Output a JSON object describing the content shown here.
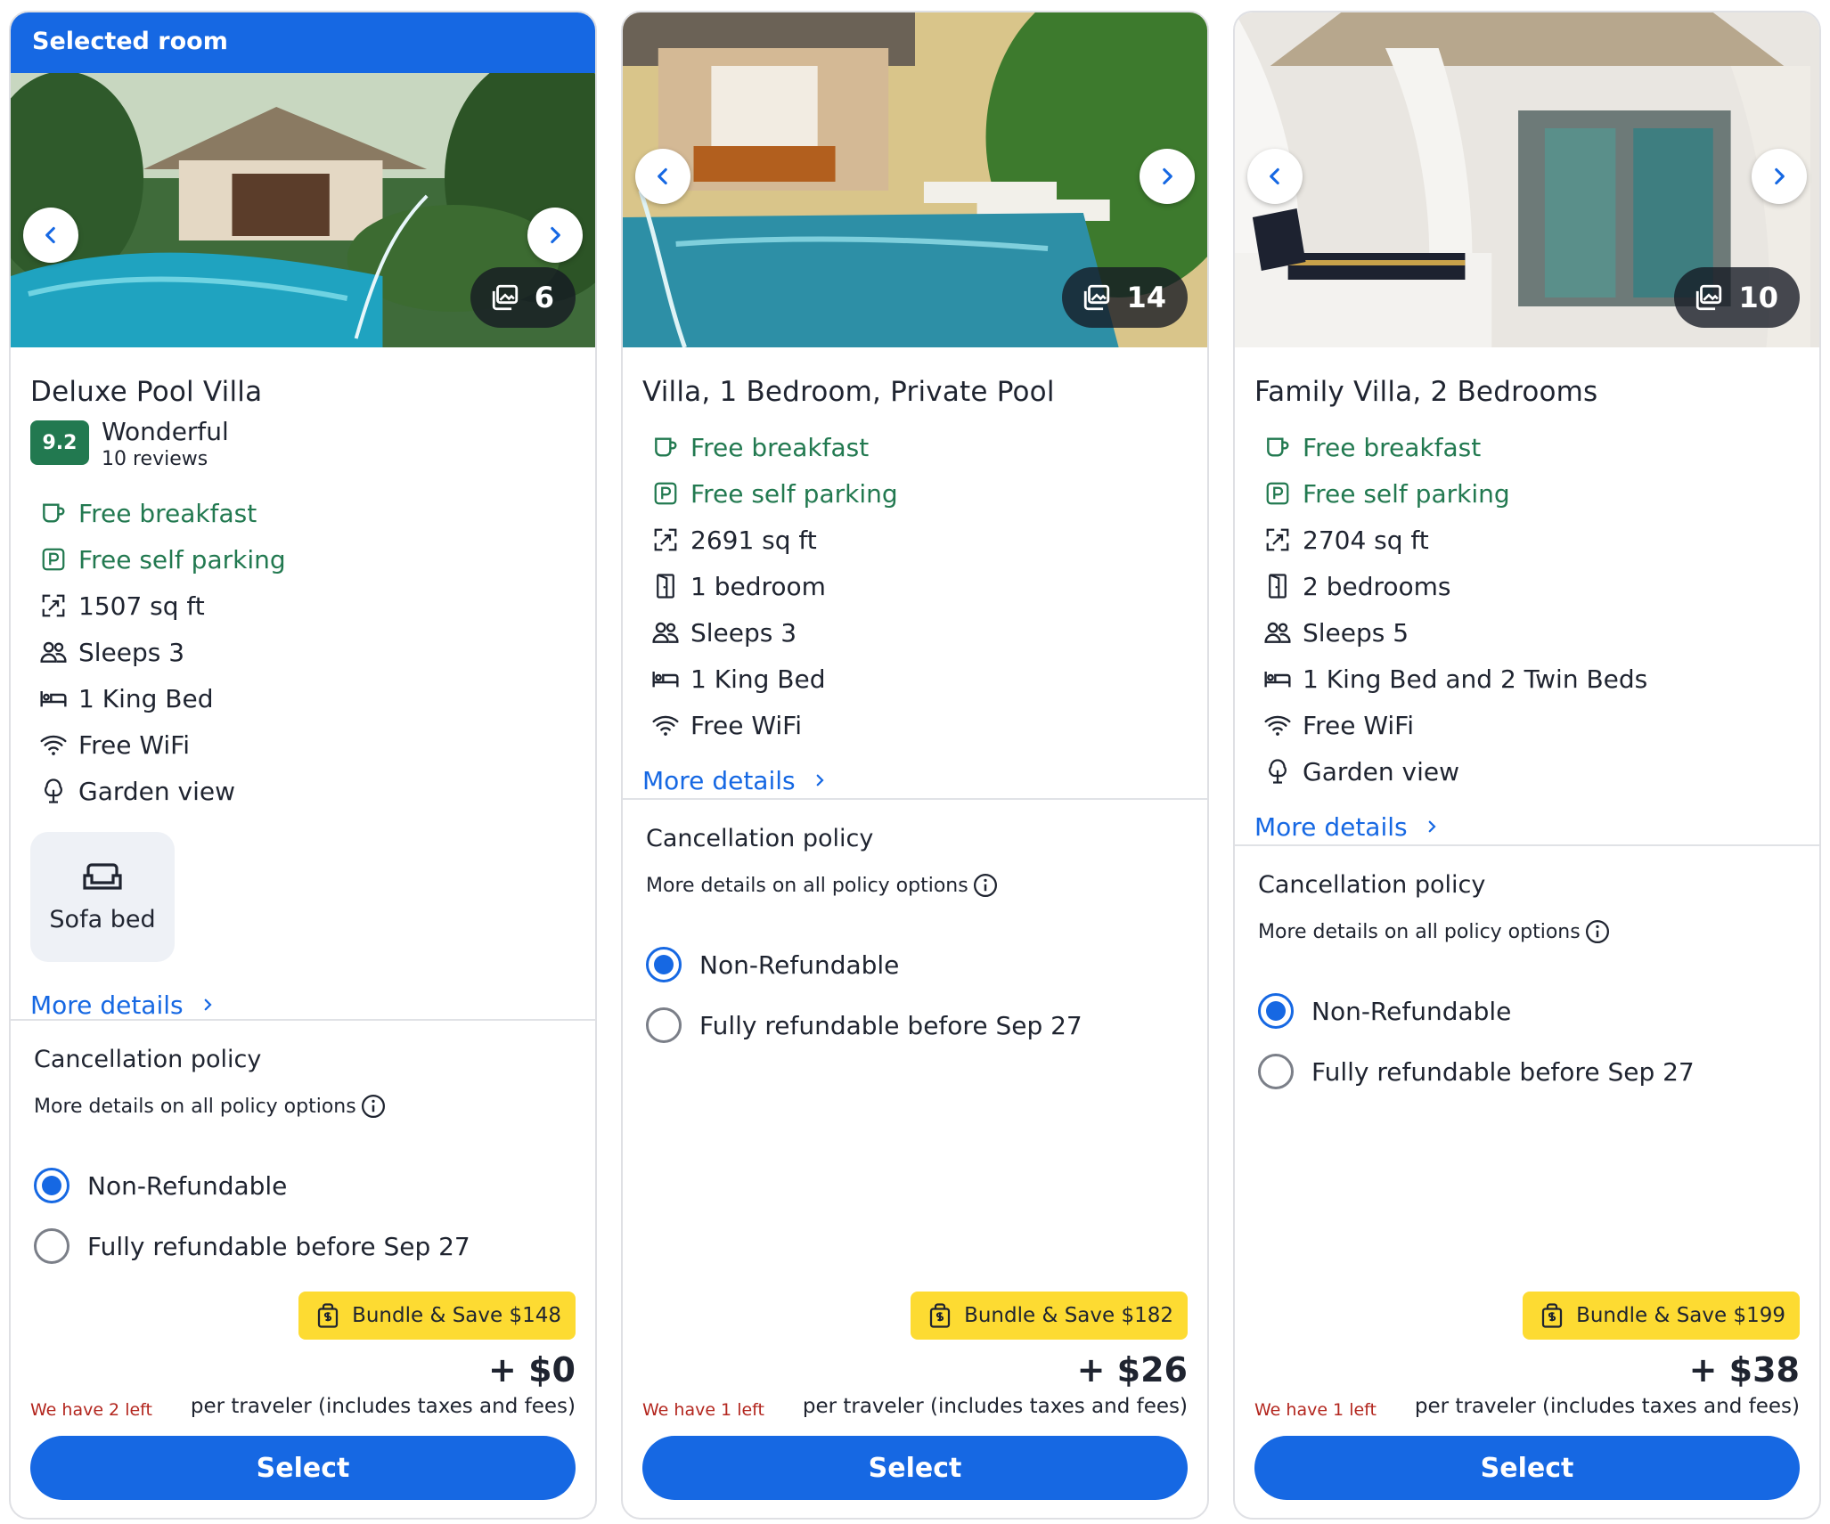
{
  "colors": {
    "accent_blue": "#1668e3",
    "amenity_green": "#227950",
    "bundle_yellow": "#fddb32",
    "scarcity_red": "#b3261e"
  },
  "cards": [
    {
      "banner": "Selected room",
      "photo_count": "6",
      "name": "Deluxe Pool Villa",
      "rating": {
        "score": "9.2",
        "label": "Wonderful",
        "reviews": "10 reviews"
      },
      "amenities": [
        {
          "icon": "coffee-cup-icon",
          "text": "Free breakfast",
          "green": true
        },
        {
          "icon": "parking-icon",
          "text": "Free self parking",
          "green": true
        },
        {
          "icon": "expand-icon",
          "text": "1507 sq ft",
          "green": false
        },
        {
          "icon": "people-icon",
          "text": "Sleeps 3",
          "green": false
        },
        {
          "icon": "bed-icon",
          "text": "1 King Bed",
          "green": false
        },
        {
          "icon": "wifi-icon",
          "text": "Free WiFi",
          "green": false
        },
        {
          "icon": "tree-icon",
          "text": "Garden view",
          "green": false
        }
      ],
      "extra_tile": {
        "icon": "sofa-icon",
        "label": "Sofa bed"
      },
      "more_details": "More details",
      "policy_title": "Cancellation policy",
      "policy_sub": "More details on all policy options",
      "options": [
        {
          "label": "Non-Refundable",
          "checked": true
        },
        {
          "label": "Fully refundable before Sep 27",
          "checked": false
        }
      ],
      "bundle": "Bundle & Save $148",
      "price": "+ $0",
      "per_traveler": "per traveler (includes taxes and fees)",
      "left": "We have 2 left",
      "select": "Select"
    },
    {
      "photo_count": "14",
      "name": "Villa, 1 Bedroom, Private Pool",
      "amenities": [
        {
          "icon": "coffee-cup-icon",
          "text": "Free breakfast",
          "green": true
        },
        {
          "icon": "parking-icon",
          "text": "Free self parking",
          "green": true
        },
        {
          "icon": "expand-icon",
          "text": "2691 sq ft",
          "green": false
        },
        {
          "icon": "door-icon",
          "text": "1 bedroom",
          "green": false
        },
        {
          "icon": "people-icon",
          "text": "Sleeps 3",
          "green": false
        },
        {
          "icon": "bed-icon",
          "text": "1 King Bed",
          "green": false
        },
        {
          "icon": "wifi-icon",
          "text": "Free WiFi",
          "green": false
        }
      ],
      "more_details": "More details",
      "policy_title": "Cancellation policy",
      "policy_sub": "More details on all policy options",
      "options": [
        {
          "label": "Non-Refundable",
          "checked": true
        },
        {
          "label": "Fully refundable before Sep 27",
          "checked": false
        }
      ],
      "bundle": "Bundle & Save $182",
      "price": "+ $26",
      "per_traveler": "per traveler (includes taxes and fees)",
      "left": "We have 1 left",
      "select": "Select"
    },
    {
      "photo_count": "10",
      "name": "Family Villa, 2 Bedrooms",
      "amenities": [
        {
          "icon": "coffee-cup-icon",
          "text": "Free breakfast",
          "green": true
        },
        {
          "icon": "parking-icon",
          "text": "Free self parking",
          "green": true
        },
        {
          "icon": "expand-icon",
          "text": "2704 sq ft",
          "green": false
        },
        {
          "icon": "door-icon",
          "text": "2 bedrooms",
          "green": false
        },
        {
          "icon": "people-icon",
          "text": "Sleeps 5",
          "green": false
        },
        {
          "icon": "bed-icon",
          "text": "1 King Bed and 2 Twin Beds",
          "green": false
        },
        {
          "icon": "wifi-icon",
          "text": "Free WiFi",
          "green": false
        },
        {
          "icon": "tree-icon",
          "text": "Garden view",
          "green": false
        }
      ],
      "more_details": "More details",
      "policy_title": "Cancellation policy",
      "policy_sub": "More details on all policy options",
      "options": [
        {
          "label": "Non-Refundable",
          "checked": true
        },
        {
          "label": "Fully refundable before Sep 27",
          "checked": false
        }
      ],
      "bundle": "Bundle & Save $199",
      "price": "+ $38",
      "per_traveler": "per traveler (includes taxes and fees)",
      "left": "We have 1 left",
      "select": "Select"
    }
  ]
}
